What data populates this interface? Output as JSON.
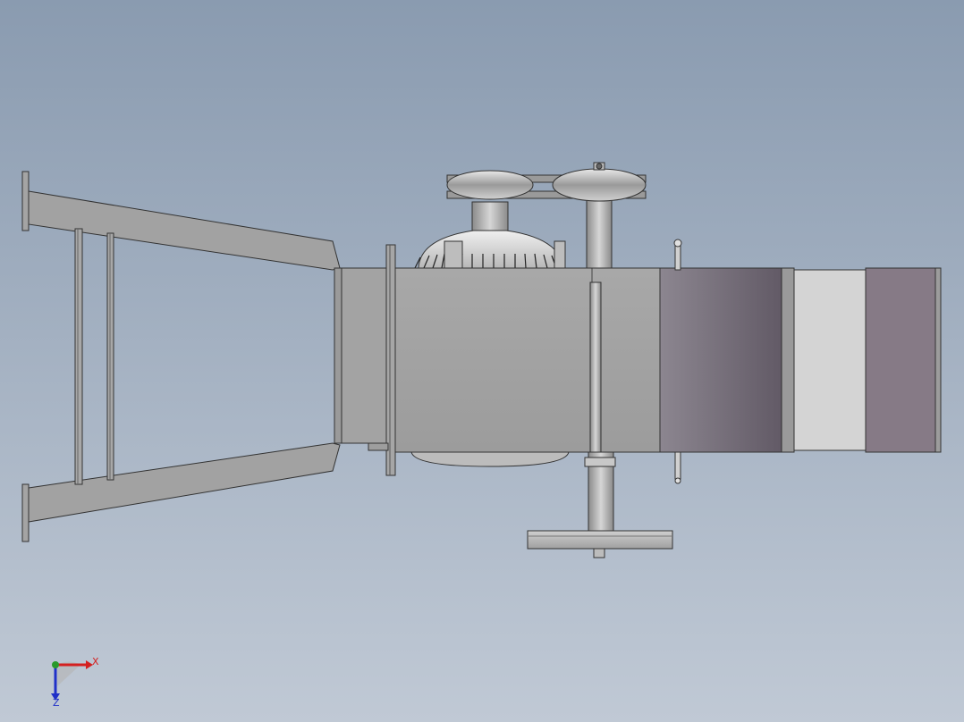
{
  "viewport": {
    "background_top": "#8a9bb0",
    "background_bottom": "#c0c9d5"
  },
  "model": {
    "components": [
      "frame-arms",
      "main-duct",
      "motor",
      "pulley-drive",
      "belt",
      "shaft",
      "handwheel",
      "lever-pin"
    ]
  },
  "triad": {
    "x_label": "X",
    "z_label": "Z",
    "x_color": "#d42020",
    "y_color": "#2a9a2a",
    "z_color": "#2030c8"
  }
}
